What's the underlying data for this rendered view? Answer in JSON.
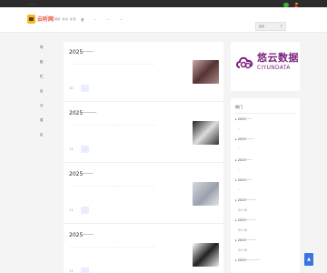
{
  "topbar": {
    "text": "·········"
  },
  "header": {
    "logo_text": "云听网",
    "slogan": "倾听·共享·交流",
    "nav": [
      "首",
      "···",
      "···",
      "···"
    ],
    "search_placeholder": "搜索···",
    "search_icon": "search-icon"
  },
  "leftnav": {
    "items": [
      "导",
      "航",
      "栏",
      "目",
      "分",
      "类",
      "区"
    ]
  },
  "posts": [
    {
      "title": "2025······",
      "desc": "····································································································",
      "desc2": "··",
      "meta": "10",
      "tag": "···"
    },
    {
      "title": "2025········",
      "desc": "····································································································",
      "desc2": "··",
      "meta": "11",
      "tag": "···"
    },
    {
      "title": "2025······",
      "desc": "····································································································",
      "desc2": "··",
      "meta": "11",
      "tag": "···"
    },
    {
      "title": "2025······",
      "desc": "····································································································",
      "desc2": "··",
      "meta": "11",
      "tag": "···"
    }
  ],
  "ad": {
    "cn": "悠云数据",
    "en": "CIYUNDATA"
  },
  "hot": {
    "title": "热门",
    "items": [
      {
        "label": "2025······",
        "sub": "··"
      },
      {
        "label": "2025········",
        "sub": "··"
      },
      {
        "label": "2025······",
        "sub": "··"
      },
      {
        "label": "2025······",
        "sub": "··"
      },
      {
        "label": "2025··········",
        "sub": "04-30"
      },
      {
        "label": "2025··········",
        "sub": "04-30"
      },
      {
        "label": "2025··········",
        "sub": "04-30"
      },
      {
        "label": "2025··············",
        "sub": ""
      }
    ]
  },
  "colors": {
    "accent": "#3a74e0",
    "logo_red": "#e74c3c",
    "tag_bg": "#e9edff",
    "ad_purple": "#7a1f7a"
  },
  "backtop_icon": "arrow-up-icon"
}
